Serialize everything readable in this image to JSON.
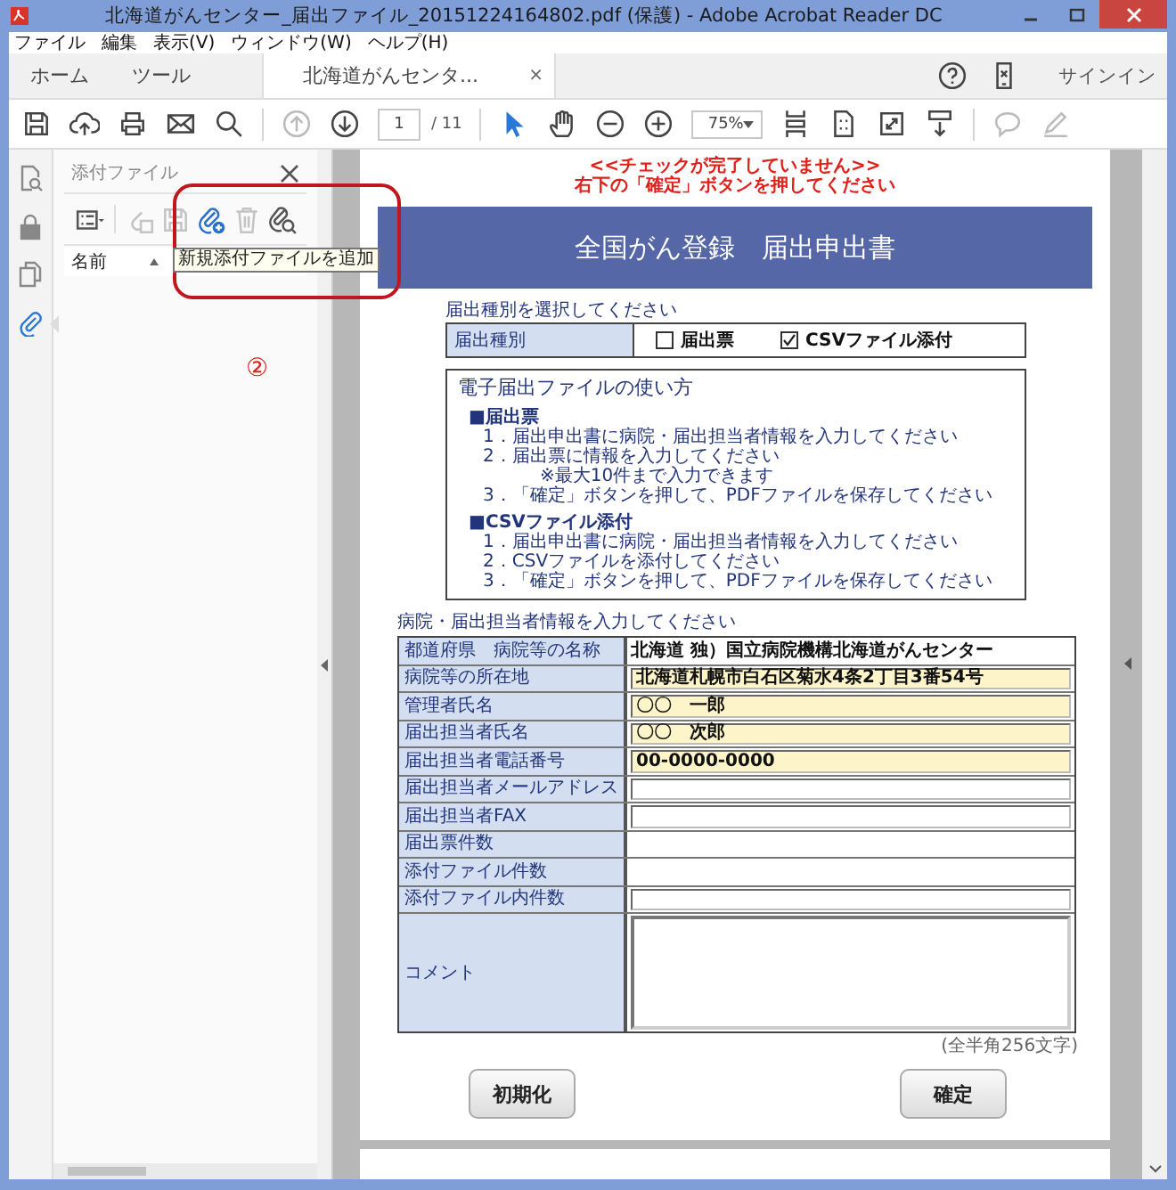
{
  "window": {
    "title": "北海道がんセンター_届出ファイル_20151224164802.pdf (保護) - Adobe Acrobat Reader DC"
  },
  "menu": [
    {
      "label": "ファイル"
    },
    {
      "label": "編集"
    },
    {
      "label": "表示(V)"
    },
    {
      "label": "ウィンドウ(W)"
    },
    {
      "label": "ヘルプ(H)"
    }
  ],
  "tabs": [
    {
      "label": "ホーム",
      "selected": false
    },
    {
      "label": "ツール",
      "selected": false
    },
    {
      "label": "北海道がんセンタ...",
      "selected": true,
      "close": "×"
    }
  ],
  "account": {
    "signin": "サインイン"
  },
  "toolbar": {
    "groups": [
      [
        {
          "kind": "save",
          "disabled": false
        },
        {
          "kind": "upload",
          "disabled": false
        },
        {
          "kind": "print",
          "disabled": false
        },
        {
          "kind": "mail",
          "disabled": false
        },
        {
          "kind": "search",
          "disabled": false
        }
      ],
      [
        {
          "kind": "up",
          "disabled": true
        },
        {
          "kind": "down",
          "disabled": false
        },
        {
          "kind": "page",
          "value": "1",
          "total": "/ 11"
        }
      ],
      [
        {
          "kind": "pointer",
          "disabled": false,
          "selected": true
        },
        {
          "kind": "hand",
          "disabled": false,
          "selected": false
        },
        {
          "kind": "zoomout",
          "disabled": false
        },
        {
          "kind": "zoomin",
          "disabled": false
        },
        {
          "kind": "zoom",
          "value": "75%"
        },
        {
          "kind": "fitpage",
          "disabled": false
        },
        {
          "kind": "page1",
          "disabled": false
        },
        {
          "kind": "fullscreen",
          "disabled": false
        },
        {
          "kind": "readmode",
          "disabled": false
        }
      ],
      [
        {
          "kind": "comment",
          "disabled": true
        },
        {
          "kind": "sign",
          "disabled": true
        }
      ]
    ]
  },
  "rail": [
    {
      "kind": "tools",
      "selected": false
    },
    {
      "kind": "lock",
      "selected": false
    },
    {
      "kind": "pages",
      "selected": false
    },
    {
      "kind": "clip",
      "selected": true
    }
  ],
  "attachments_panel": {
    "title": "添付ファイル",
    "tools": [
      {
        "kind": "options",
        "disabled": false
      },
      {
        "kind": "open",
        "disabled": true
      },
      {
        "kind": "save",
        "disabled": true
      },
      {
        "kind": "add",
        "disabled": false
      },
      {
        "kind": "delete",
        "disabled": true
      },
      {
        "kind": "find",
        "disabled": false
      }
    ],
    "column": "名前",
    "tooltip": "新規添付ファイルを追加",
    "annotation": {
      "marker": "②"
    }
  },
  "document": {
    "notice": [
      "<<チェックが完了していません>>",
      "右下の「確定」ボタンを押してください"
    ],
    "header": "全国がん登録　届出申出書",
    "type_section": {
      "heading": "届出種別を選択してください",
      "label": "届出種別",
      "options": [
        {
          "label": "届出票",
          "checked": false
        },
        {
          "label": "CSVファイル添付",
          "checked": true
        }
      ]
    },
    "guide": {
      "title": "電子届出ファイルの使い方",
      "blocks": [
        {
          "heading": "■届出票",
          "lines": [
            {
              "kind": "step",
              "text": "1．届出申出書に病院・届出担当者情報を入力してください"
            },
            {
              "kind": "step",
              "text": "2．届出票に情報を入力してください"
            },
            {
              "kind": "note",
              "text": "※最大10件まで入力できます"
            },
            {
              "kind": "step",
              "text": "3．「確定」ボタンを押して、PDFファイルを保存してください"
            }
          ]
        },
        {
          "heading": "■CSVファイル添付",
          "lines": [
            {
              "kind": "step",
              "text": "1．届出申出書に病院・届出担当者情報を入力してください"
            },
            {
              "kind": "step",
              "text": "2．CSVファイルを添付してください"
            },
            {
              "kind": "step",
              "text": "3．「確定」ボタンを押して、PDFファイルを保存してください"
            }
          ]
        }
      ]
    },
    "info_section": {
      "heading": "病院・届出担当者情報を入力してください",
      "rows": [
        {
          "label": "都道府県　病院等の名称",
          "kind": "text",
          "value": "北海道 独）国立病院機構北海道がんセンター"
        },
        {
          "label": "病院等の所在地",
          "kind": "field",
          "value": "北海道札幌市白石区菊水4条2丁目3番54号",
          "highlighted": true
        },
        {
          "label": "管理者氏名",
          "kind": "field",
          "value": "〇〇　一郎",
          "highlighted": true
        },
        {
          "label": "届出担当者氏名",
          "kind": "field",
          "value": "〇〇　次郎",
          "highlighted": true
        },
        {
          "label": "届出担当者電話番号",
          "kind": "field",
          "value": "00-0000-0000",
          "highlighted": true
        },
        {
          "label": "届出担当者メールアドレス",
          "kind": "field",
          "highlighted": false
        },
        {
          "label": "届出担当者FAX",
          "kind": "field",
          "highlighted": false
        },
        {
          "label": "届出票件数",
          "kind": "text"
        },
        {
          "label": "添付ファイル件数",
          "kind": "text"
        },
        {
          "label": "添付ファイル内件数",
          "kind": "field",
          "highlighted": false
        },
        {
          "label": "コメント",
          "kind": "textarea"
        }
      ],
      "note": "(全半角256文字)"
    },
    "buttons": [
      {
        "label": "初期化"
      },
      {
        "label": "確定"
      }
    ]
  }
}
